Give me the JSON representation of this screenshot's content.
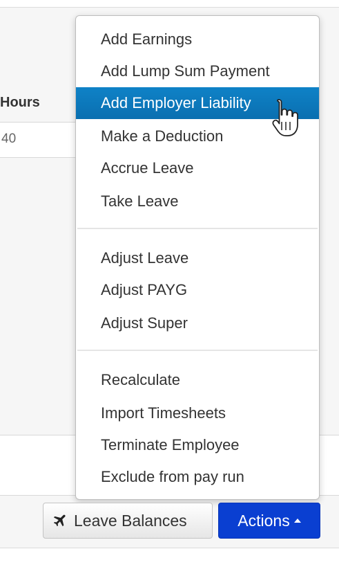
{
  "table": {
    "column_header": "Hours",
    "row_value": "40"
  },
  "menu": {
    "items": [
      {
        "label": "Add Earnings"
      },
      {
        "label": "Add Lump Sum Payment"
      },
      {
        "label": "Add Employer Liability",
        "active": true
      },
      {
        "label": "Make a Deduction"
      },
      {
        "label": "Accrue Leave"
      },
      {
        "label": "Take Leave"
      },
      {
        "label": "Adjust Leave"
      },
      {
        "label": "Adjust PAYG"
      },
      {
        "label": "Adjust Super"
      },
      {
        "label": "Recalculate"
      },
      {
        "label": "Import Timesheets"
      },
      {
        "label": "Terminate Employee"
      },
      {
        "label": "Exclude from pay run"
      }
    ]
  },
  "toolbar": {
    "leave_balances_label": "Leave Balances",
    "actions_label": "Actions"
  },
  "colors": {
    "menu_highlight": "#0f82c7",
    "actions_button": "#0a3fd1"
  },
  "icons": {
    "leave_balances": "plane-icon",
    "actions_caret": "caret-up-icon",
    "cursor": "hand-pointer-icon"
  }
}
